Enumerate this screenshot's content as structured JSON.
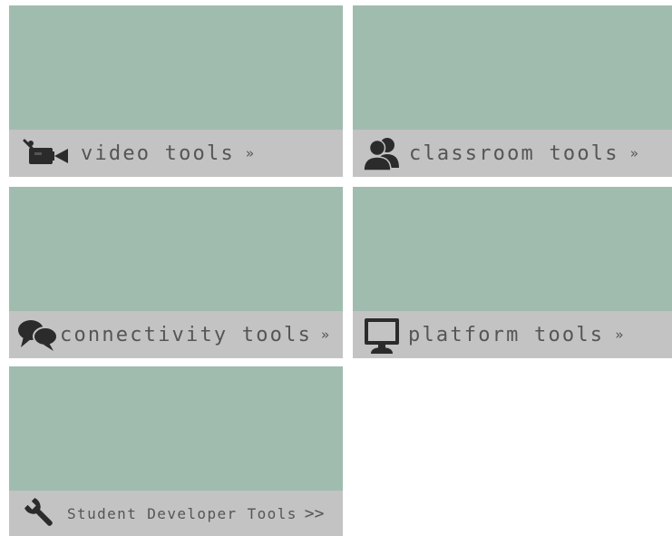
{
  "colors": {
    "image_placeholder": "#a0bcaf",
    "caption_bar": "#c3c3c3",
    "caption_text": "#555555",
    "icon": "#2b2b2b"
  },
  "tiles": [
    {
      "label": "video tools",
      "arrows": "»",
      "icon": "video-camera-icon"
    },
    {
      "label": "classroom tools",
      "arrows": "»",
      "icon": "people-icon"
    },
    {
      "label": "connectivity tools",
      "arrows": "»",
      "icon": "chat-bubbles-icon"
    },
    {
      "label": "platform tools",
      "arrows": "»",
      "icon": "monitor-icon"
    },
    {
      "label": "Student Developer Tools",
      "arrows": ">>",
      "icon": "wrench-icon"
    }
  ]
}
